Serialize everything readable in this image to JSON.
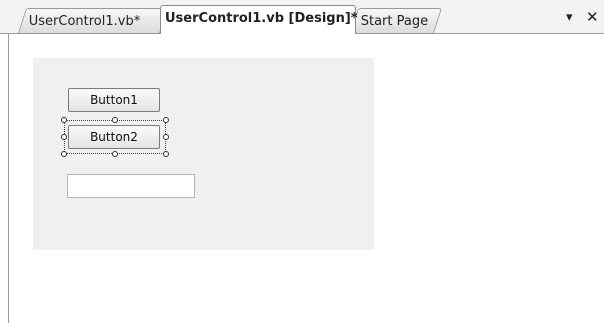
{
  "tabs": [
    {
      "label": "UserControl1.vb*",
      "active": false
    },
    {
      "label": "UserControl1.vb [Design]*",
      "active": true
    },
    {
      "label": "Start Page",
      "active": false
    }
  ],
  "controls": {
    "button1_label": "Button1",
    "button2_label": "Button2",
    "textbox_value": ""
  },
  "icons": {
    "dropdown": "dropdown-icon",
    "close": "close-icon"
  },
  "colors": {
    "surface": "#f0f0f0",
    "tabstrip": "#f3f3f3"
  }
}
